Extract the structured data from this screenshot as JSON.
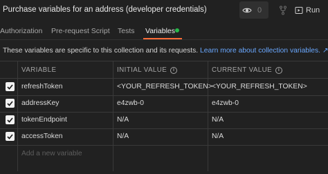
{
  "header": {
    "title": "Purchase variables for an address (developer credentials)",
    "watch_count": "0",
    "run_label": "Run"
  },
  "tabs": [
    {
      "label": "Authorization"
    },
    {
      "label": "Pre-request Script"
    },
    {
      "label": "Tests"
    },
    {
      "label": "Variables"
    }
  ],
  "info": {
    "text": "These variables are specific to this collection and its requests.",
    "link": "Learn more about collection variables. ↗"
  },
  "table": {
    "columns": [
      "VARIABLE",
      "INITIAL VALUE",
      "CURRENT VALUE"
    ],
    "rows": [
      {
        "variable": "refreshToken",
        "initial": "<YOUR_REFRESH_TOKEN>",
        "current": "<YOUR_REFRESH_TOKEN>",
        "checked": true
      },
      {
        "variable": "addressKey",
        "initial": "e4zwb-0",
        "current": "e4zwb-0",
        "checked": true
      },
      {
        "variable": "tokenEndpoint",
        "initial": "N/A",
        "current": "N/A",
        "checked": true
      },
      {
        "variable": "accessToken",
        "initial": "N/A",
        "current": "N/A",
        "checked": true
      }
    ],
    "add_placeholder": "Add a new variable"
  },
  "colors": {
    "background": "#212121",
    "accent": "#ff6c37",
    "link": "#6aa8ff",
    "status_dot": "#27b84a"
  },
  "icons": [
    "eye-icon",
    "fork-icon",
    "run-icon",
    "info-icon",
    "checkbox-check-icon"
  ]
}
